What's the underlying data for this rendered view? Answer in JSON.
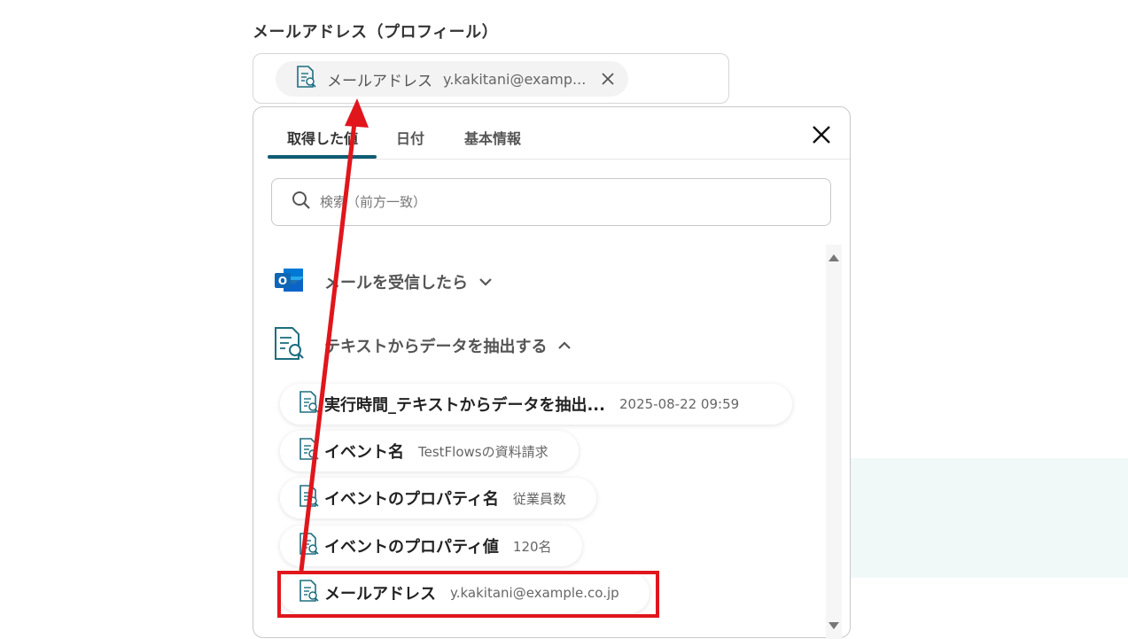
{
  "field": {
    "label": "メールアドレス（プロフィール）",
    "chip": {
      "label": "メールアドレス",
      "value": "y.kakitani@examp..."
    }
  },
  "dropdown": {
    "tabs": [
      {
        "label": "取得した値",
        "active": true
      },
      {
        "label": "日付"
      },
      {
        "label": "基本情報"
      }
    ],
    "search": {
      "placeholder": "検索（前方一致）"
    },
    "sections": [
      {
        "label": "メールを受信したら",
        "icon": "outlook-icon",
        "expanded": false
      },
      {
        "label": "テキストからデータを抽出する",
        "icon": "document-search-icon",
        "expanded": true
      }
    ],
    "items": [
      {
        "label": "実行時間_テキストからデータを抽出...",
        "value": "2025-08-22 09:59"
      },
      {
        "label": "イベント名",
        "value": "TestFlowsの資料請求"
      },
      {
        "label": "イベントのプロパティ名",
        "value": "従業員数"
      },
      {
        "label": "イベントのプロパティ値",
        "value": "120名"
      },
      {
        "label": "メールアドレス",
        "value": "y.kakitani@example.co.jp"
      }
    ]
  },
  "colors": {
    "accent": "#0f5c73",
    "annotation": "#e0161c",
    "outlook_blue": "#0a64c8",
    "icon_teal": "#1e6e80"
  }
}
